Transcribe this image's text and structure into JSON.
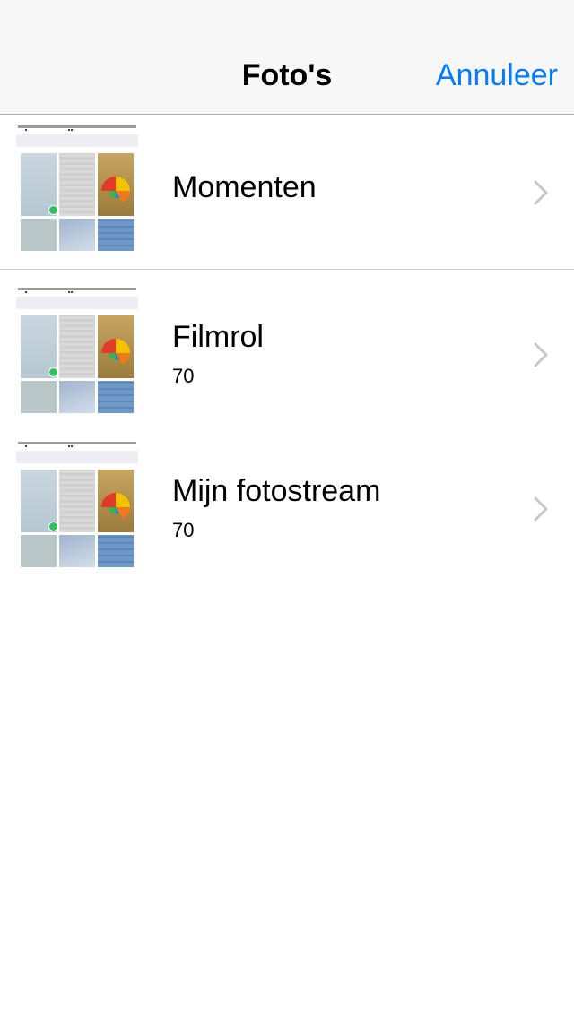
{
  "navbar": {
    "title": "Foto's",
    "cancel_label": "Annuleer"
  },
  "albums": [
    {
      "name": "Momenten",
      "count": ""
    },
    {
      "name": "Filmrol",
      "count": "70"
    },
    {
      "name": "Mijn fotostream",
      "count": "70"
    }
  ],
  "icons": {
    "chevron": "chevron-right-icon",
    "check": "check-badge-icon"
  },
  "colors": {
    "accent": "#007aff",
    "navbar_bg": "#f7f7f7",
    "separator": "#c8c7cc",
    "chevron": "#c7c7cc",
    "check": "#2fc15c"
  }
}
